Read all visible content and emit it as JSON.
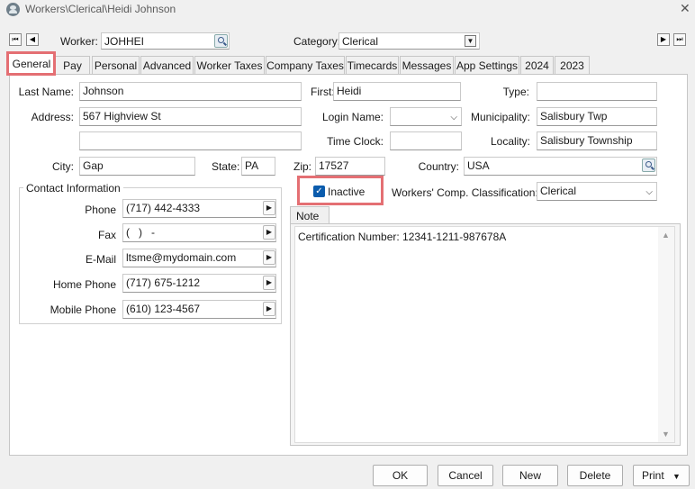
{
  "window": {
    "title": "Workers\\Clerical\\Heidi Johnson",
    "app_icon": "worker-icon",
    "close_icon": "close-icon"
  },
  "topbar": {
    "worker_label": "Worker:",
    "worker_value": "JOHHEI",
    "category_label": "Category:",
    "category_value": "Clerical"
  },
  "tabs": [
    {
      "label": "General",
      "active": true
    },
    {
      "label": "Pay"
    },
    {
      "label": "Personal"
    },
    {
      "label": "Advanced"
    },
    {
      "label": "Worker Taxes"
    },
    {
      "label": "Company Taxes"
    },
    {
      "label": "Timecards"
    },
    {
      "label": "Messages"
    },
    {
      "label": "App Settings"
    },
    {
      "label": "2024"
    },
    {
      "label": "2023"
    }
  ],
  "form": {
    "last_name_label": "Last Name:",
    "last_name": "Johnson",
    "first_label": "First:",
    "first": "Heidi",
    "type_label": "Type:",
    "type": "",
    "address_label": "Address:",
    "address1": "567 Highview St",
    "address2": "",
    "login_name_label": "Login Name:",
    "login_name": "",
    "municipality_label": "Municipality:",
    "municipality": "Salisbury Twp",
    "time_clock_label": "Time Clock:",
    "time_clock": "",
    "locality_label": "Locality:",
    "locality": "Salisbury Township",
    "city_label": "City:",
    "city": "Gap",
    "state_label": "State:",
    "state": "PA",
    "zip_label": "Zip:",
    "zip": "17527",
    "country_label": "Country:",
    "country": "USA",
    "inactive_label": "Inactive",
    "inactive_checked": true,
    "wc_label": "Workers' Comp. Classification:",
    "wc_value": "Clerical"
  },
  "contact": {
    "group_label": "Contact Information",
    "phone_label": "Phone",
    "phone": "(717) 442-4333",
    "fax_label": "Fax",
    "fax": "(   )   -",
    "email_label": "E-Mail",
    "email": "ltsme@mydomain.com",
    "home_phone_label": "Home Phone",
    "home_phone": "(717) 675-1212",
    "mobile_phone_label": "Mobile Phone",
    "mobile_phone": "(610) 123-4567"
  },
  "note": {
    "tab_label": "Note",
    "text": "Certification Number: 12341-1211-987678A"
  },
  "buttons": {
    "ok": "OK",
    "cancel": "Cancel",
    "new": "New",
    "delete": "Delete",
    "print": "Print"
  },
  "colors": {
    "highlight": "#e46f73",
    "checkbox": "#0b5cad"
  }
}
